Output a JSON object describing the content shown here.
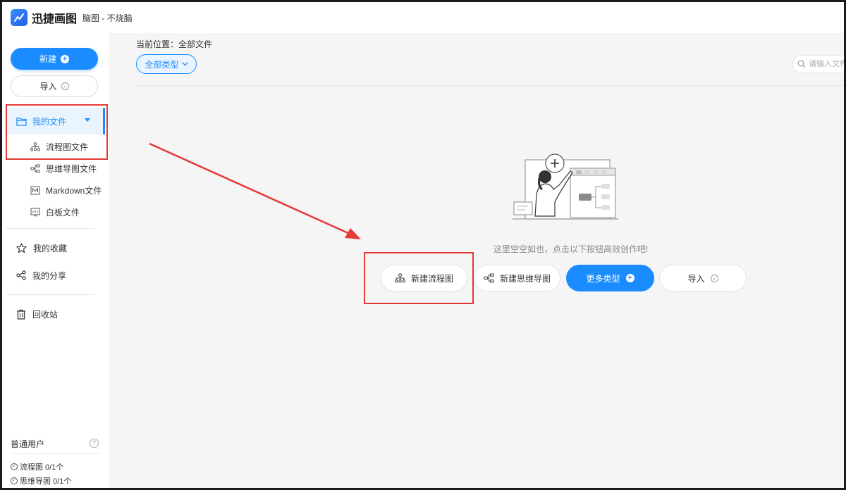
{
  "header": {
    "app_name": "迅捷画图",
    "doc_title": "脑图 - 不烧脑",
    "brand_color": "#1a8cff"
  },
  "sidebar": {
    "new_button": "新建",
    "import_button": "导入",
    "my_files": "我的文件",
    "sub_items": [
      {
        "label": "流程图文件",
        "icon": "flowchart-icon"
      },
      {
        "label": "思维导图文件",
        "icon": "mindmap-icon"
      },
      {
        "label": "Markdown文件",
        "icon": "markdown-icon"
      },
      {
        "label": "白板文件",
        "icon": "whiteboard-icon"
      }
    ],
    "favorites": "我的收藏",
    "shares": "我的分享",
    "trash": "回收站",
    "user_type": "普通用户",
    "quota": [
      {
        "label": "流程图 0/1个"
      },
      {
        "label": "思维导图 0/1个"
      }
    ]
  },
  "main": {
    "breadcrumb": "当前位置：全部文件",
    "filter_label": "全部类型",
    "search_placeholder": "请输入文件",
    "empty_text": "这里空空如也，点击以下按钮高效创作吧!",
    "actions": {
      "new_flowchart": "新建流程图",
      "new_mindmap": "新建思维导图",
      "more_types": "更多类型",
      "import": "导入"
    }
  },
  "annotations": {
    "highlight_color": "#e53935"
  }
}
